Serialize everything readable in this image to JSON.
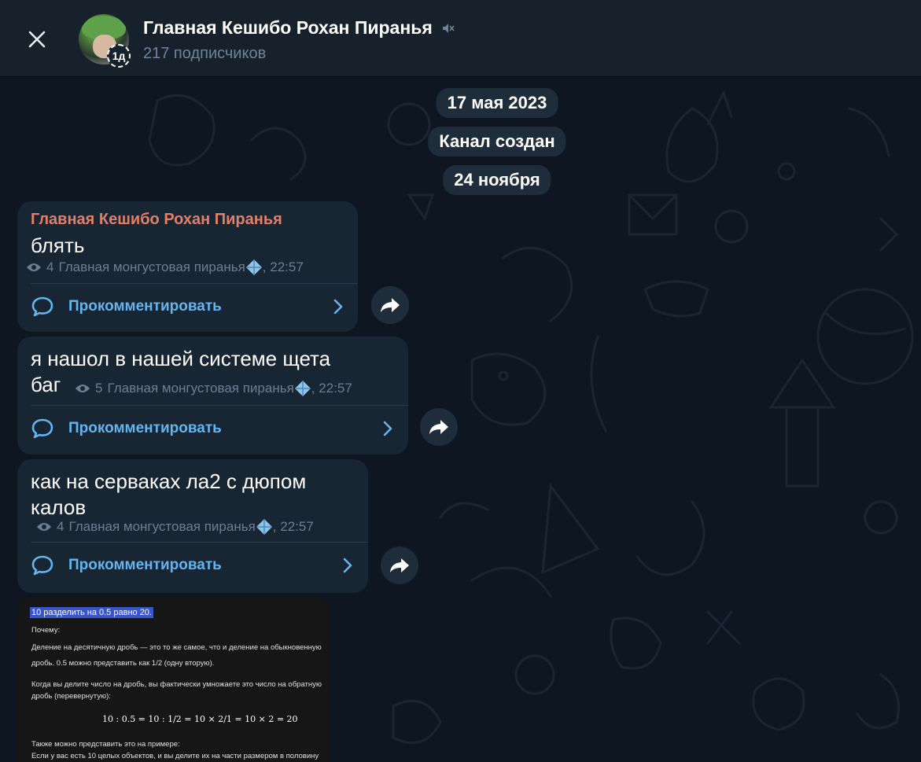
{
  "header": {
    "title": "Главная Кешибо Рохан Пиранья",
    "subtitle": "217 подписчиков",
    "timer_badge": "1д",
    "close_icon": "close-icon",
    "muted_icon": "muted-speaker-icon"
  },
  "dates": {
    "d1": "17 мая 2023",
    "system": "Канал создан",
    "d2": "24 ноября"
  },
  "messages": [
    {
      "sender": "Главная Кешибо Рохан Пиранья",
      "text": "блять",
      "views": "4",
      "signature": "Главная монгустовая пиранья",
      "time": "22:57",
      "comment_label": "Прокомментировать"
    },
    {
      "text_line1": "я нашол в нашей системе щета",
      "text_line2": "баг",
      "views": "5",
      "signature": "Главная монгустовая пиранья",
      "time": "22:57",
      "comment_label": "Прокомментировать"
    },
    {
      "text_line1": "как на серваках ла2 с дюпом",
      "text_line2": "калов",
      "views": "4",
      "signature": "Главная монгустовая пиранья",
      "time": "22:57",
      "comment_label": "Прокомментировать"
    }
  ],
  "photo": {
    "highlight": "10 разделить на 0.5 равно 20.",
    "l1": "Почему:",
    "l2": "Деление на десятичную дробь — это то же самое, что и деление на обыкновенную",
    "l3": "дробь. 0.5 можно представить как 1/2 (одну вторую).",
    "l4": "Когда вы делите число на дробь, вы фактически умножаете это число на обратную",
    "l5": "дробь (перевернутую):",
    "formula": "10 : 0.5 = 10 : 1/2 = 10 × 2/1 = 10 × 2 = 20",
    "l6": "Также можно представить это на примере:",
    "l7": "Если у вас есть 10 целых объектов, и вы делите их на части размером в половину"
  },
  "colors": {
    "chat_bg": "#0e1621",
    "header_bg": "#17212b",
    "bubble_bg": "#182533",
    "accent": "#64b5ef",
    "sender": "#e17f69",
    "meta": "#6d7f8f"
  }
}
